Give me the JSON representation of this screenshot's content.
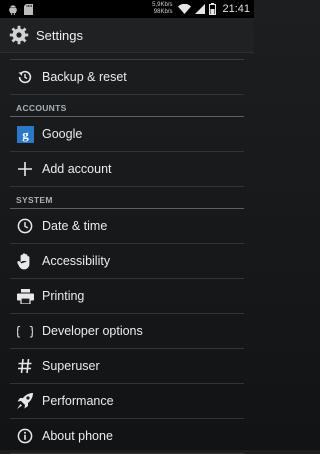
{
  "status_bar": {
    "net_up": "5,9Kb/s",
    "net_down": "98Kb/s",
    "time": "21:41"
  },
  "action_bar": {
    "title": "Settings"
  },
  "items": {
    "backup": "Backup & reset",
    "google": "Google",
    "add_account": "Add account",
    "date_time": "Date & time",
    "accessibility": "Accessibility",
    "printing": "Printing",
    "developer": "Developer options",
    "superuser": "Superuser",
    "performance": "Performance",
    "about": "About phone"
  },
  "sections": {
    "accounts": "ACCOUNTS",
    "system": "SYSTEM"
  },
  "colors": {
    "google_icon_bg": "#2a78c6",
    "section_text": "#a9b0b5"
  }
}
